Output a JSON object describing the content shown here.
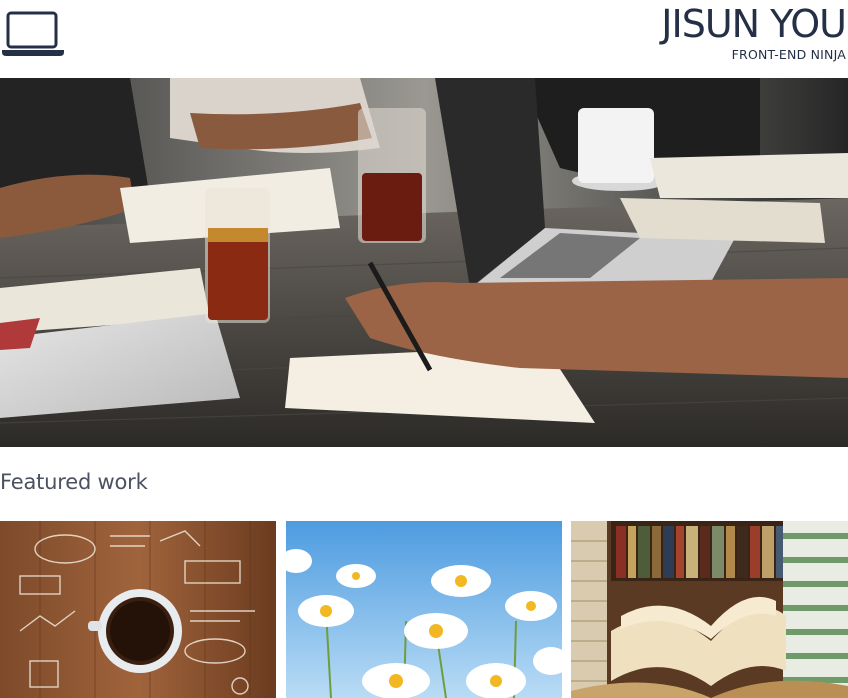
{
  "header": {
    "logo_icon": "laptop-icon",
    "name": "JISUN YOU",
    "tagline": "FRONT-END NINJA"
  },
  "hero": {
    "image": "team-working-at-table-photo"
  },
  "featured": {
    "title": "Featured work",
    "items": [
      {
        "image": "coffee-and-sketches-photo"
      },
      {
        "image": "daisies-sky-photo"
      },
      {
        "image": "open-books-library-photo"
      }
    ]
  },
  "colors": {
    "text": "#253047",
    "section_title": "#4b5161"
  }
}
